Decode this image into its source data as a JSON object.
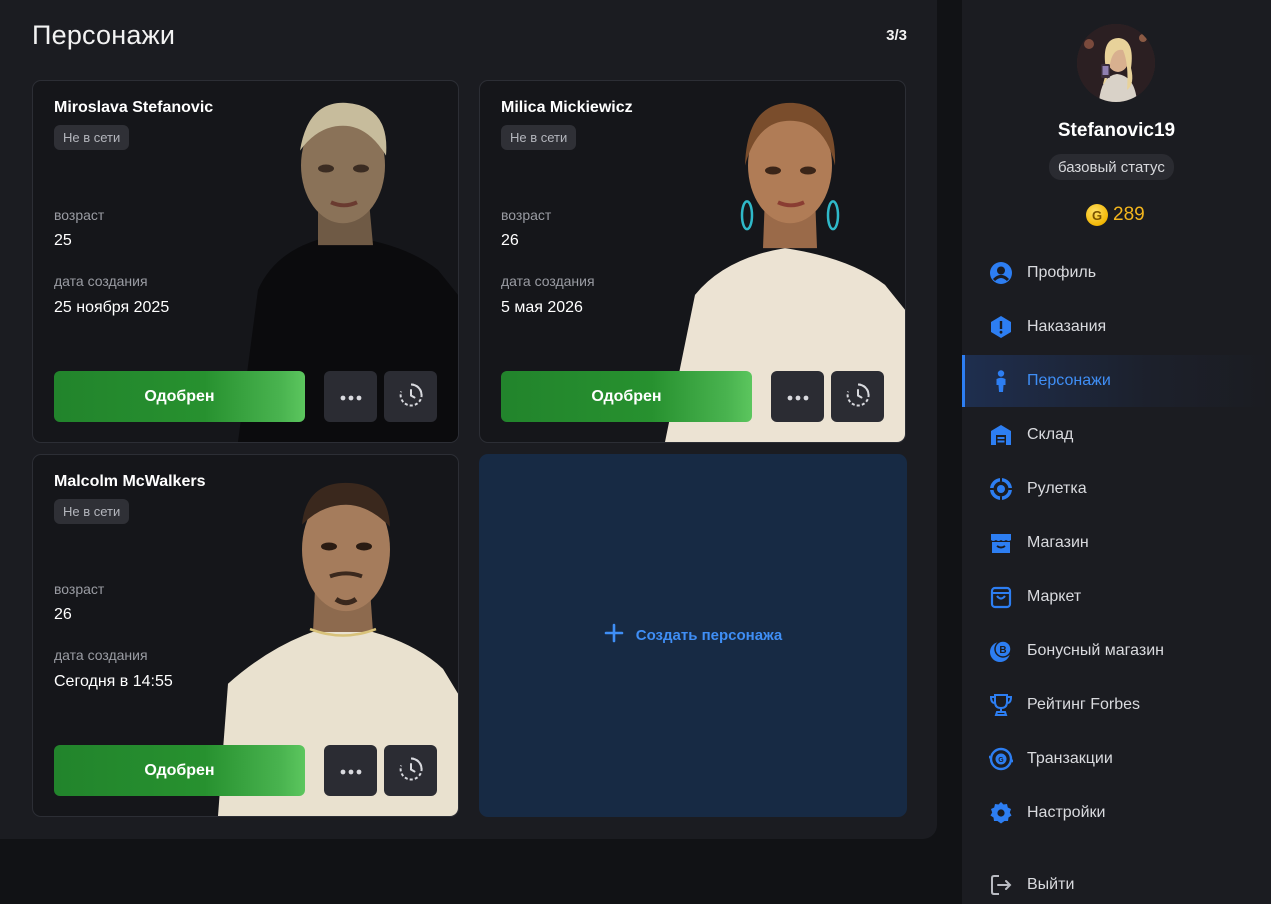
{
  "main": {
    "title": "Персонажи",
    "count": "3/3",
    "characters": [
      {
        "name": "Miroslava Stefanovic",
        "status": "Не в сети",
        "age_label": "возраст",
        "age": "25",
        "created_label": "дата создания",
        "created": "25 ноября 2025",
        "approve_label": "Одобрен"
      },
      {
        "name": "Milica Mickiewicz",
        "status": "Не в сети",
        "age_label": "возраст",
        "age": "26",
        "created_label": "дата создания",
        "created": "5 мая 2026",
        "approve_label": "Одобрен"
      },
      {
        "name": "Malcolm McWalkers",
        "status": "Не в сети",
        "age_label": "возраст",
        "age": "26",
        "created_label": "дата создания",
        "created": "Сегодня в 14:55",
        "approve_label": "Одобрен"
      }
    ],
    "create_label": "Создать персонажа"
  },
  "sidebar": {
    "username": "Stefanovic19",
    "status": "базовый статус",
    "coin_letter": "G",
    "balance": "289",
    "items": [
      {
        "label": "Профиль",
        "icon": "user-circle-icon"
      },
      {
        "label": "Наказания",
        "icon": "warning-hexagon-icon"
      },
      {
        "label": "Персонажи",
        "icon": "person-icon",
        "active": true
      },
      {
        "label": "Склад",
        "icon": "warehouse-icon"
      },
      {
        "label": "Рулетка",
        "icon": "roulette-icon"
      },
      {
        "label": "Магазин",
        "icon": "store-icon"
      },
      {
        "label": "Маркет",
        "icon": "shopping-bag-icon"
      },
      {
        "label": "Бонусный магазин",
        "icon": "bonus-coin-icon"
      },
      {
        "label": "Рейтинг Forbes",
        "icon": "trophy-icon"
      },
      {
        "label": "Транзакции",
        "icon": "transactions-icon"
      },
      {
        "label": "Настройки",
        "icon": "gear-icon"
      }
    ],
    "logout_label": "Выйти"
  },
  "colors": {
    "accent": "#3f8ef5",
    "approve": "#27912f",
    "coin": "#f3b51d",
    "create_bg": "#172a44"
  }
}
